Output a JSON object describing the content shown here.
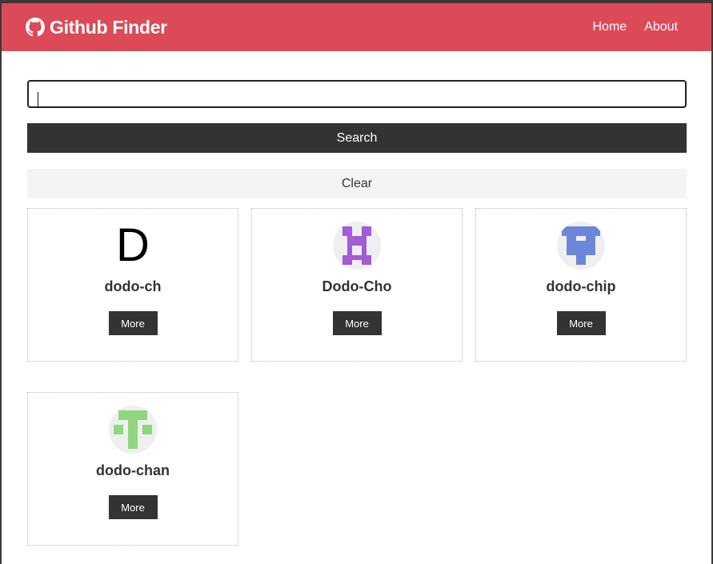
{
  "colors": {
    "navbar": "#dc4a57",
    "dark": "#333333",
    "light": "#f4f4f4"
  },
  "navbar": {
    "brand_icon": "github-icon",
    "brand": "Github Finder",
    "links": [
      {
        "label": "Home"
      },
      {
        "label": "About"
      }
    ]
  },
  "search": {
    "value": "",
    "placeholder": "",
    "submit_label": "Search",
    "clear_label": "Clear"
  },
  "users": [
    {
      "login": "dodo-ch",
      "avatar": "letter-d-icon",
      "more_label": "More"
    },
    {
      "login": "Dodo-Cho",
      "avatar": "purple-identicon",
      "more_label": "More"
    },
    {
      "login": "dodo-chip",
      "avatar": "blue-identicon",
      "more_label": "More"
    },
    {
      "login": "dodo-chan",
      "avatar": "green-identicon",
      "more_label": "More"
    }
  ]
}
